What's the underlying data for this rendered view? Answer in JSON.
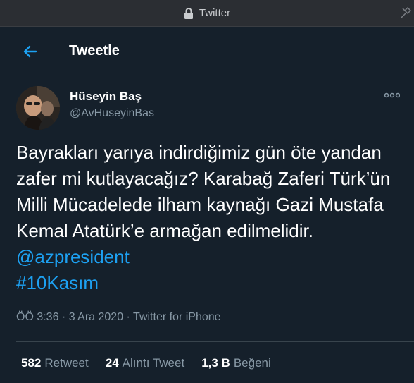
{
  "window": {
    "title": "Twitter",
    "lock_icon": "lock-icon",
    "pin_icon": "pin-icon"
  },
  "header": {
    "back_icon": "arrow-left-icon",
    "title": "Tweetle"
  },
  "author": {
    "display_name": "Hüseyin Baş",
    "handle": "@AvHuseyinBas",
    "more_icon": "more-horizontal-icon"
  },
  "tweet": {
    "text_part1": "Bayrakları yarıya indirdiğimiz gün öte yandan zafer mi kutlayacağız? Karabağ Zaferi Türk’ün Milli Mücadelede ilham kaynağı Gazi Mustafa Kemal Atatürk’e armağan edilmelidir. ",
    "mention": "@azpresident",
    "hashtag": "#10Kasım"
  },
  "meta": {
    "time": "ÖÖ 3:36",
    "sep1": " · ",
    "date": "3 Ara 2020",
    "sep2": " · ",
    "source": "Twitter for iPhone"
  },
  "stats": {
    "retweets_count": "582",
    "retweets_label": "Retweet",
    "quotes_count": "24",
    "quotes_label": "Alıntı Tweet",
    "likes_count": "1,3 B",
    "likes_label": "Beğeni"
  },
  "colors": {
    "background": "#15202b",
    "accent": "#1da1f2",
    "muted": "#8899a6",
    "border": "#38444d"
  }
}
